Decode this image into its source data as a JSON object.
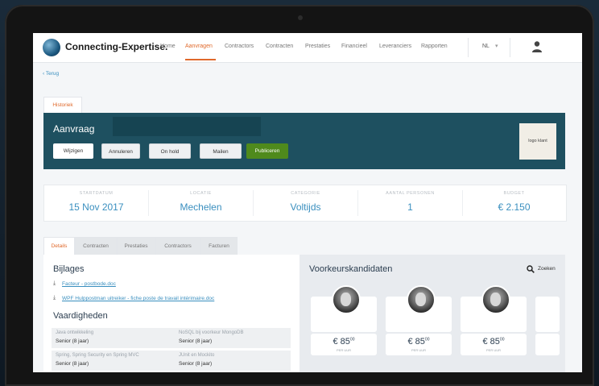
{
  "app": {
    "brand": "Connecting-Expertise."
  },
  "nav": {
    "items": [
      "Home",
      "Aanvragen",
      "Contractors",
      "Contracten",
      "Prestaties",
      "Financieel",
      "Leveranciers",
      "Rapporten"
    ],
    "active_index": 1,
    "language": "NL",
    "language_caret": "▾",
    "accent_color": "#e0692b"
  },
  "back_link": "‹ Terug",
  "history_tab": "Historiek",
  "request": {
    "title": "Aanvraag",
    "buttons": {
      "edit": "Wijzigen",
      "cancel": "Annuleren",
      "hold": "On hold",
      "mail": "Mailen",
      "publish": "Publiceren"
    },
    "client_logo": "logo klant",
    "band_color": "#1e5060",
    "publish_color": "#4f8a1c"
  },
  "stats": [
    {
      "label": "STARTDATUM",
      "value": "15 Nov 2017"
    },
    {
      "label": "LOCATIE",
      "value": "Mechelen"
    },
    {
      "label": "CATEGORIE",
      "value": "Voltijds"
    },
    {
      "label": "AANTAL PERSONEN",
      "value": "1"
    },
    {
      "label": "BUDGET",
      "value": "€ 2.150"
    }
  ],
  "detail_tabs": [
    "Details",
    "Contracten",
    "Prestaties",
    "Contractors",
    "Facturen"
  ],
  "attachments": {
    "title": "Bijlages",
    "files": [
      "Facteur - postbode.doc",
      "WPF Hulppostman uitreiker - fiche poste de travail intérimaire.doc"
    ]
  },
  "skills": {
    "title": "Vaardigheden",
    "rows": [
      [
        {
          "name": "Java ontwikkeling",
          "level": "Senior (8 jaar)"
        },
        {
          "name": "NoSQL bij voorkeur MongoDB",
          "level": "Senior (8 jaar)"
        }
      ],
      [
        {
          "name": "Spring, Spring Security en Spring MVC",
          "level": "Senior (8 jaar)"
        },
        {
          "name": "JUnit en Mockito",
          "level": "Senior (8 jaar)"
        }
      ]
    ]
  },
  "candidates": {
    "title": "Voorkeurskandidaten",
    "search_label": "Zoeken",
    "items": [
      {
        "price": "€ 85",
        "cents": "00",
        "unit": "PER UUR"
      },
      {
        "price": "€ 85",
        "cents": "00",
        "unit": "PER UUR"
      },
      {
        "price": "€ 85",
        "cents": "00",
        "unit": "PER UUR"
      }
    ]
  },
  "icons": {
    "back": "chevron-left-icon",
    "user": "user-icon",
    "search": "search-icon",
    "download": "download-icon"
  }
}
